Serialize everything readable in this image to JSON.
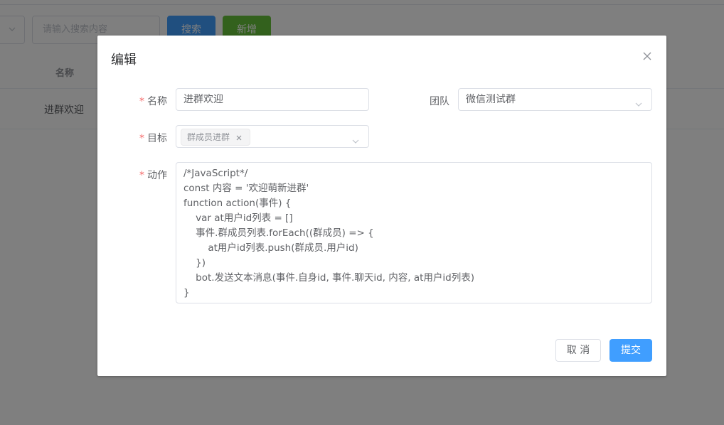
{
  "background": {
    "search_placeholder": "请输入搜索内容",
    "search_button": "搜索",
    "add_button": "新增",
    "table_header_name": "名称",
    "row_name": "进群欢迎"
  },
  "dialog": {
    "title": "编辑",
    "fields": {
      "name_label": "名称",
      "name_value": "进群欢迎",
      "team_label": "团队",
      "team_value": "微信测试群",
      "target_label": "目标",
      "target_tag": "群成员进群",
      "action_label": "动作",
      "required_mark": "*"
    },
    "code_lines": [
      "/*JavaScript*/",
      "const 内容 = '欢迎萌新进群'",
      "function action(事件) {",
      "\tvar at用户id列表 = []",
      "\t事件.群成员列表.forEach((群成员) => {",
      "\t\tat用户id列表.push(群成员.用户id)",
      "\t})",
      "\tbot.发送文本消息(事件.自身id, 事件.聊天id, 内容, at用户id列表)",
      "}"
    ],
    "cancel_label": "取 消",
    "submit_label": "提交"
  },
  "colors": {
    "primary": "#409eff",
    "success": "#67c23a",
    "required": "#f56c6c"
  }
}
